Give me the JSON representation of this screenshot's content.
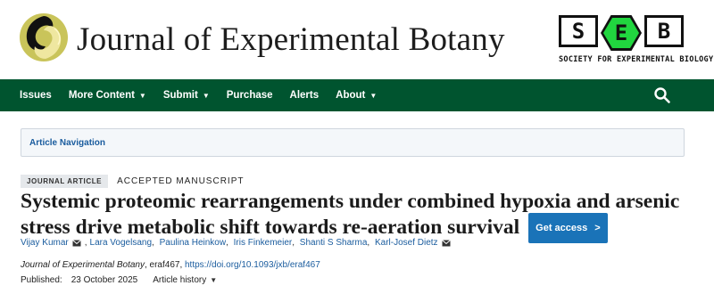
{
  "header": {
    "journal_title": "Journal of Experimental Botany",
    "journal_logo": "leaf-swirl-logo",
    "seb": {
      "letters": [
        "S",
        "E",
        "B"
      ],
      "caption": "SOCIETY FOR EXPERIMENTAL BIOLOGY",
      "accent": "#21d63f"
    }
  },
  "nav": {
    "background": "#00542f",
    "items": [
      {
        "label": "Issues",
        "dropdown": false
      },
      {
        "label": "More Content",
        "dropdown": true
      },
      {
        "label": "Submit",
        "dropdown": true
      },
      {
        "label": "Purchase",
        "dropdown": false
      },
      {
        "label": "Alerts",
        "dropdown": false
      },
      {
        "label": "About",
        "dropdown": true
      }
    ],
    "search_icon": "search-icon"
  },
  "article_nav": {
    "label": "Article Navigation"
  },
  "article": {
    "type_badge": "JOURNAL ARTICLE",
    "status": "ACCEPTED MANUSCRIPT",
    "title": "Systemic proteomic rearrangements under combined hypoxia and arsenic stress drive metabolic shift towards re-aeration survival",
    "get_access": "Get access",
    "authors": [
      {
        "name": "Vijay Kumar",
        "email": true
      },
      {
        "name": "Lara Vogelsang",
        "email": false
      },
      {
        "name": "Paulina Heinkow",
        "email": false
      },
      {
        "name": "Iris Finkemeier",
        "email": false
      },
      {
        "name": "Shanti S Sharma",
        "email": false
      },
      {
        "name": "Karl-Josef Dietz",
        "email": true
      }
    ],
    "citation": {
      "journal": "Journal of Experimental Botany",
      "article_id": ", eraf467, ",
      "doi": "https://doi.org/10.1093/jxb/eraf467"
    },
    "published_label": "Published:",
    "published_date": "23 October 2025",
    "history_label": "Article history"
  },
  "colors": {
    "link": "#1a5c9e",
    "button": "#1a73b8"
  }
}
